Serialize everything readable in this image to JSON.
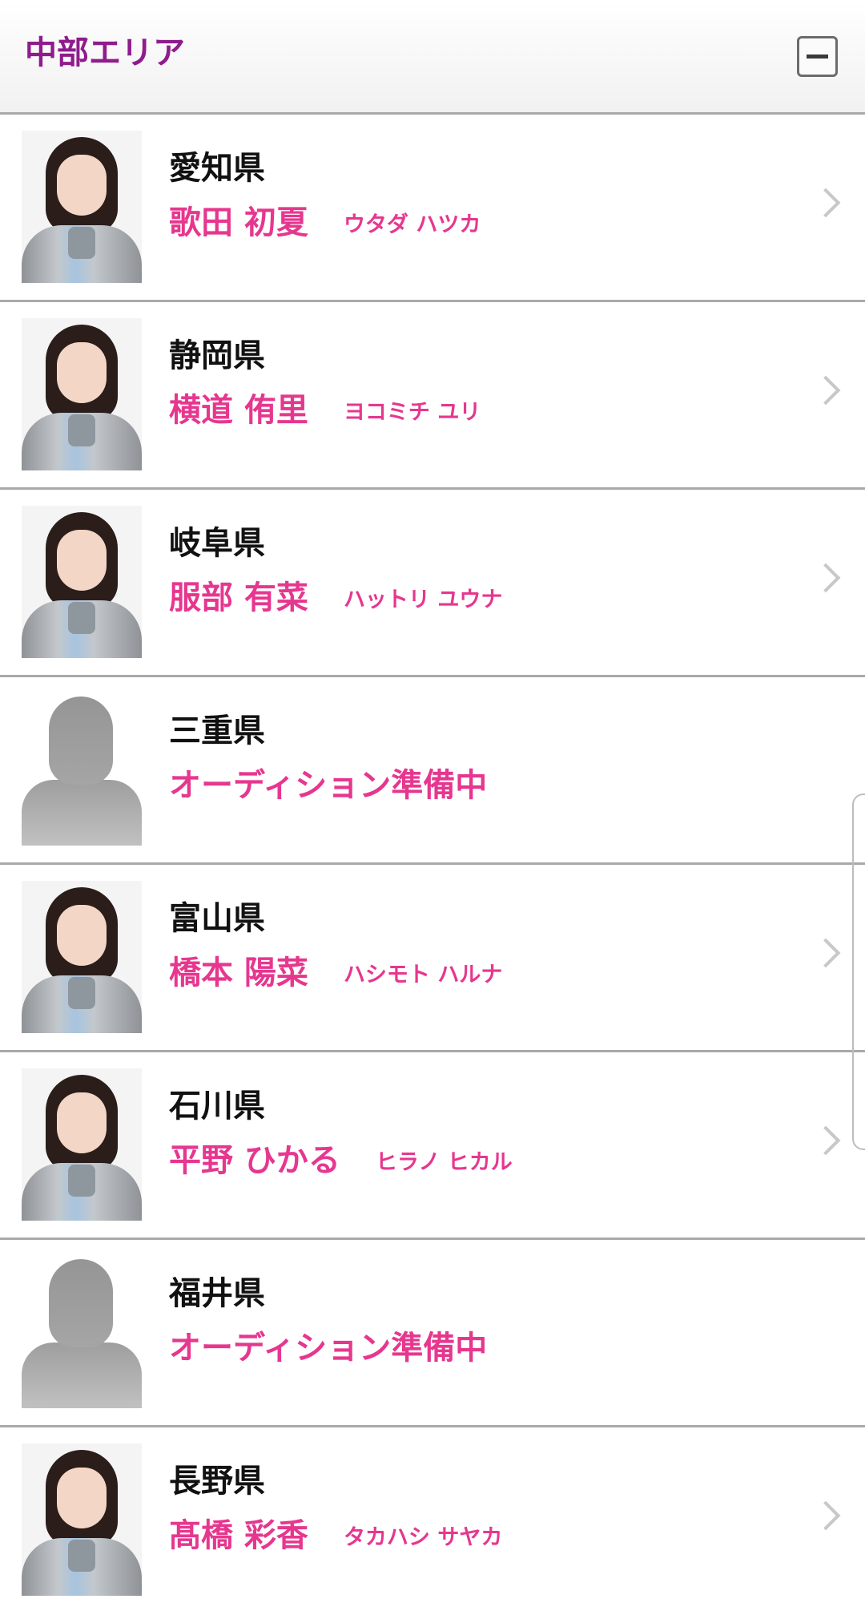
{
  "header": {
    "title": "中部エリア",
    "collapse_icon": "minus-icon"
  },
  "accent_colors": {
    "title": "#8f1c8c",
    "name": "#e6378f"
  },
  "members": [
    {
      "prefecture": "愛知県",
      "name": "歌田 初夏",
      "kana": "ウタダ ハツカ",
      "has_photo": true
    },
    {
      "prefecture": "静岡県",
      "name": "横道 侑里",
      "kana": "ヨコミチ ユリ",
      "has_photo": true
    },
    {
      "prefecture": "岐阜県",
      "name": "服部 有菜",
      "kana": "ハットリ ユウナ",
      "has_photo": true
    },
    {
      "prefecture": "三重県",
      "status": "オーディション準備中",
      "has_photo": false
    },
    {
      "prefecture": "富山県",
      "name": "橋本 陽菜",
      "kana": "ハシモト ハルナ",
      "has_photo": true
    },
    {
      "prefecture": "石川県",
      "name": "平野 ひかる",
      "kana": "ヒラノ ヒカル",
      "has_photo": true
    },
    {
      "prefecture": "福井県",
      "status": "オーディション準備中",
      "has_photo": false
    },
    {
      "prefecture": "長野県",
      "name": "髙橋 彩香",
      "kana": "タカハシ サヤカ",
      "has_photo": true
    }
  ]
}
